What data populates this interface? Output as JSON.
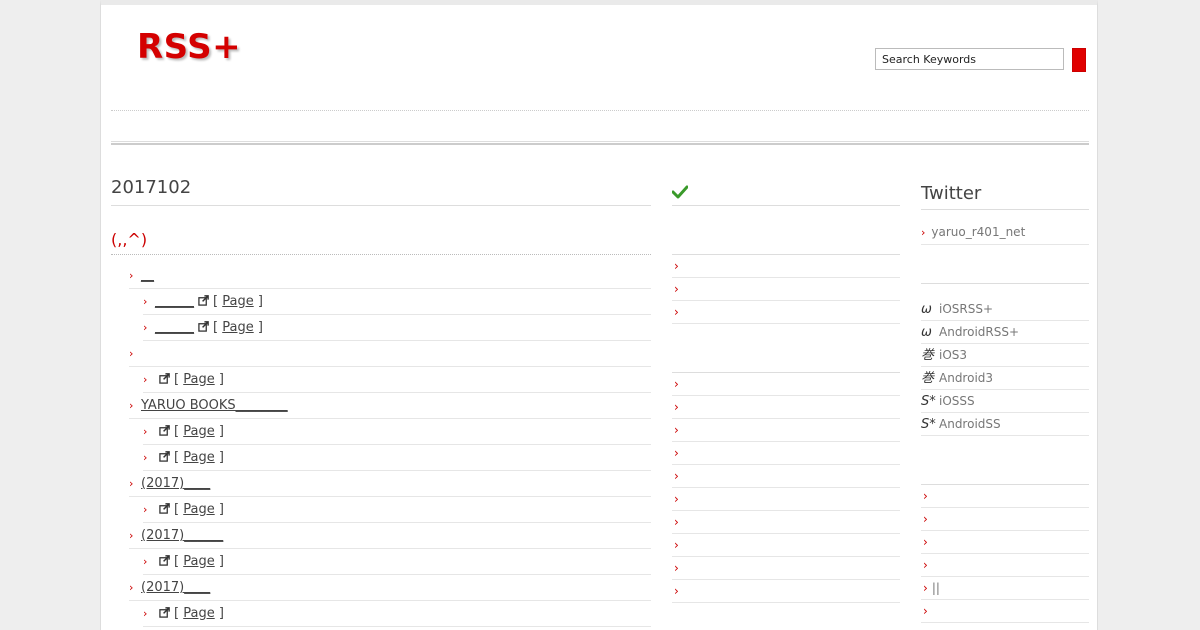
{
  "site": {
    "logo": "RSS+"
  },
  "search": {
    "placeholder": "Search Keywords"
  },
  "main": {
    "date_heading": "2017102",
    "article_title": "(,,^)",
    "entries": [
      {
        "level": 1,
        "text": "__",
        "ext": false,
        "page": ""
      },
      {
        "level": 2,
        "text": "______",
        "ext": true,
        "page": "Page"
      },
      {
        "level": 2,
        "text": "______",
        "ext": true,
        "page": "Page"
      },
      {
        "level": 1,
        "text": "",
        "ext": false,
        "page": ""
      },
      {
        "level": 2,
        "text": "",
        "ext": true,
        "page": "Page"
      },
      {
        "level": 1,
        "text": "YARUO BOOKS________",
        "ext": false,
        "page": ""
      },
      {
        "level": 2,
        "text": "",
        "ext": true,
        "page": "Page"
      },
      {
        "level": 2,
        "text": "",
        "ext": true,
        "page": "Page"
      },
      {
        "level": 1,
        "text": "(2017)____",
        "ext": false,
        "page": ""
      },
      {
        "level": 2,
        "text": "",
        "ext": true,
        "page": "Page"
      },
      {
        "level": 1,
        "text": "(2017)______",
        "ext": false,
        "page": ""
      },
      {
        "level": 2,
        "text": "",
        "ext": true,
        "page": "Page"
      },
      {
        "level": 1,
        "text": "(2017)____",
        "ext": false,
        "page": ""
      },
      {
        "level": 2,
        "text": "",
        "ext": true,
        "page": "Page"
      }
    ]
  },
  "mid": {
    "list1": [
      "",
      "",
      ""
    ],
    "list2": [
      "",
      "",
      "",
      "",
      "",
      "",
      "",
      "",
      "",
      ""
    ]
  },
  "sidebar": {
    "title": "Twitter",
    "twitter_link": "yaruo_r401_net",
    "apps": [
      {
        "icon": "ω",
        "label": "iOSRSS+"
      },
      {
        "icon": "ω",
        "label": "AndroidRSS+"
      },
      {
        "icon": "巻",
        "label": "iOS3"
      },
      {
        "icon": "巻",
        "label": "Android3"
      },
      {
        "icon": "S*",
        "label": "iOSSS"
      },
      {
        "icon": "S*",
        "label": "AndroidSS"
      }
    ],
    "list": [
      "",
      "",
      "",
      "",
      "||",
      "",
      ""
    ]
  },
  "colors": {
    "accent": "#cc0000",
    "check": "#3a9a2a"
  }
}
